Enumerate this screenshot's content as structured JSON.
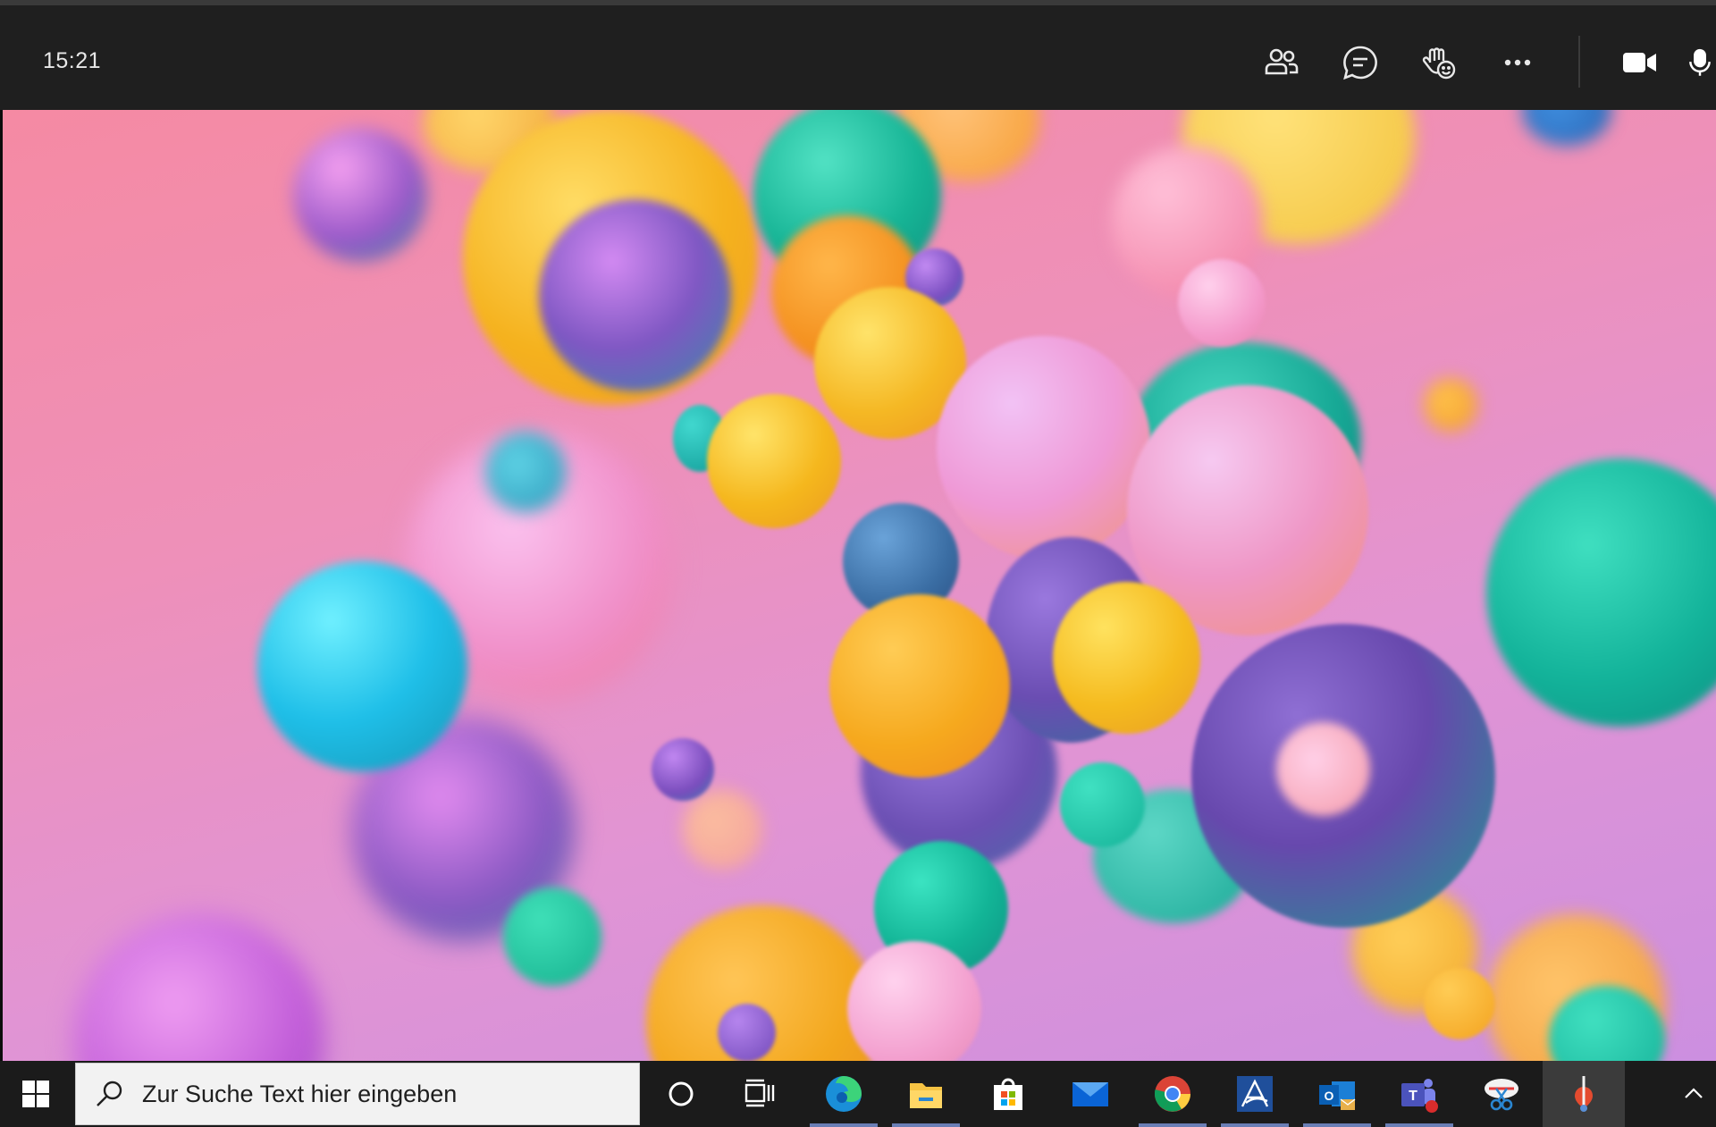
{
  "meeting": {
    "clock": "15:21",
    "toolbar": [
      {
        "name": "participants-icon"
      },
      {
        "name": "chat-icon"
      },
      {
        "name": "raise-hand-icon"
      },
      {
        "name": "more-options-icon"
      },
      {
        "name": "camera-icon"
      },
      {
        "name": "microphone-icon"
      }
    ]
  },
  "colors": {
    "topbar": "#1f1f1f",
    "taskbar": "#1b1b1b",
    "search_bg": "#f2f2f2",
    "pink": "#f58aa3",
    "violet": "#cc8fe0",
    "yellow": "#f7b21b",
    "teal": "#17b79a",
    "purple": "#7b4fb0"
  },
  "taskbar": {
    "search": {
      "placeholder": "Zur Suche Text hier eingeben"
    },
    "apps": [
      {
        "name": "cortana-icon"
      },
      {
        "name": "task-view-icon"
      },
      {
        "name": "edge-icon"
      },
      {
        "name": "file-explorer-icon"
      },
      {
        "name": "microsoft-store-icon"
      },
      {
        "name": "mail-icon"
      },
      {
        "name": "chrome-icon"
      },
      {
        "name": "app-icon"
      },
      {
        "name": "outlook-icon"
      },
      {
        "name": "teams-icon"
      },
      {
        "name": "snipping-tool-icon"
      },
      {
        "name": "active-app-icon"
      }
    ],
    "tray": {
      "name": "show-hidden-icons-icon"
    }
  }
}
